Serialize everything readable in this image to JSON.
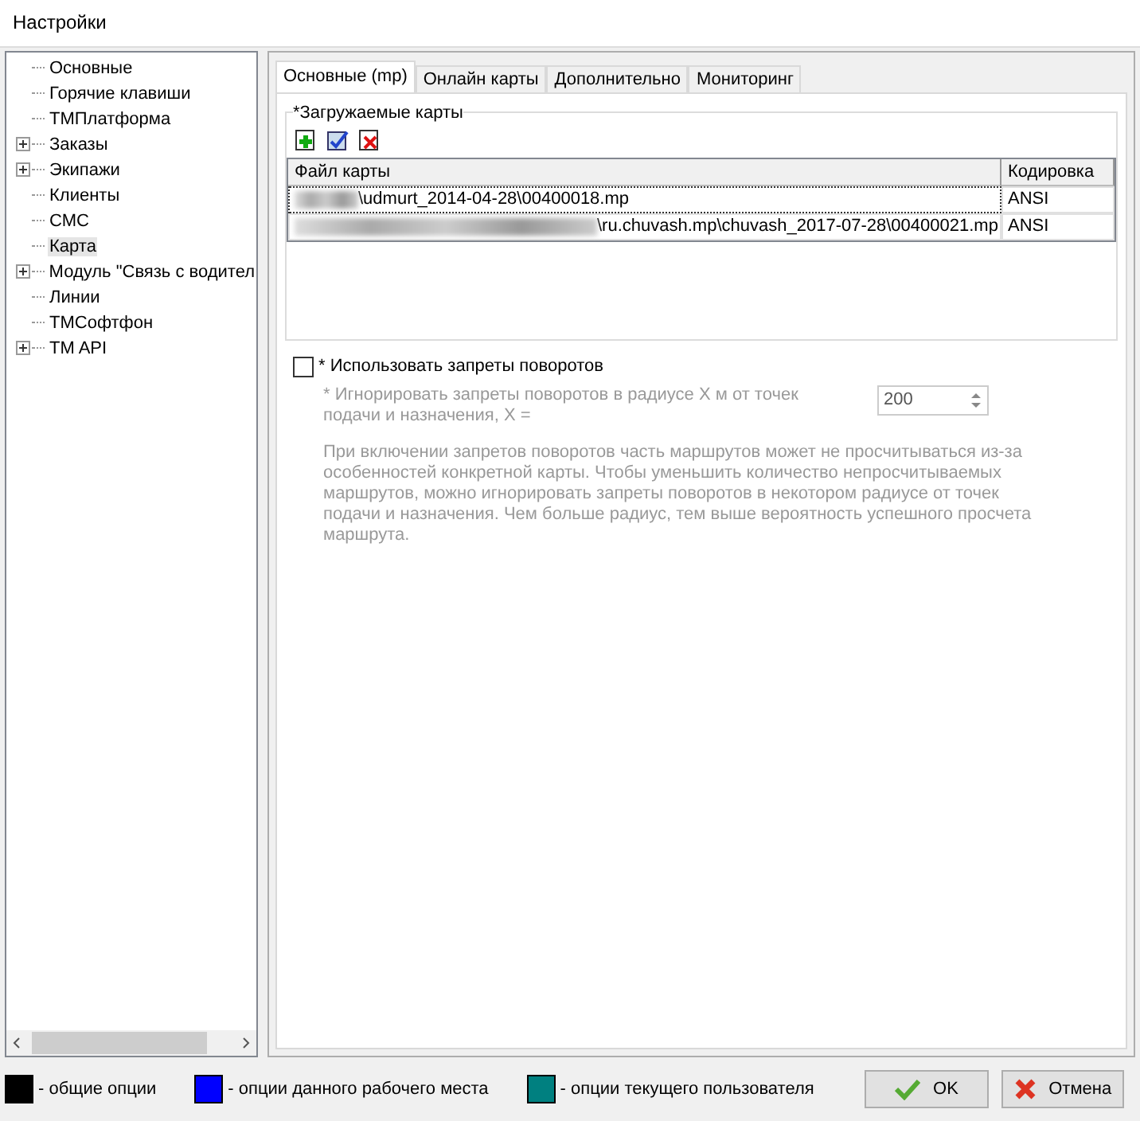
{
  "window": {
    "title": "Настройки"
  },
  "tree": [
    {
      "kind": "leaf",
      "label": "Основные",
      "selected": false
    },
    {
      "kind": "leaf",
      "label": "Горячие клавиши",
      "selected": false
    },
    {
      "kind": "leaf",
      "label": "ТМПлатформа",
      "selected": false
    },
    {
      "kind": "group",
      "label": "Заказы",
      "expanded": false,
      "selected": false
    },
    {
      "kind": "group",
      "label": "Экипажи",
      "expanded": false,
      "selected": false
    },
    {
      "kind": "leaf",
      "label": "Клиенты",
      "selected": false
    },
    {
      "kind": "leaf",
      "label": "СМС",
      "selected": false
    },
    {
      "kind": "leaf",
      "label": "Карта",
      "selected": true
    },
    {
      "kind": "group",
      "label": "Модуль \"Связь с водител",
      "expanded": false,
      "selected": false
    },
    {
      "kind": "leaf",
      "label": "Линии",
      "selected": false
    },
    {
      "kind": "leaf",
      "label": "ТМСофтфон",
      "selected": false
    },
    {
      "kind": "group",
      "label": "TM API",
      "expanded": false,
      "selected": false
    }
  ],
  "tabs": [
    {
      "label": "Основные (mp)",
      "selected": true
    },
    {
      "label": "Онлайн карты",
      "selected": false
    },
    {
      "label": "Дополнительно",
      "selected": false
    },
    {
      "label": "Мониторинг",
      "selected": false
    }
  ],
  "maps_group": {
    "title": "*Загружаемые карты",
    "table": {
      "columns": [
        "Файл карты",
        "Кодировка"
      ],
      "rows": [
        {
          "file": "\\udmurt_2014-04-28\\00400018.mp",
          "encoding": "ANSI",
          "selected": true
        },
        {
          "file": "\\ru.chuvash.mp\\chuvash_2017-07-28\\00400021.mp",
          "encoding": "ANSI",
          "selected": false
        }
      ]
    }
  },
  "turn_restrictions": {
    "label": "* Использовать запреты поворотов",
    "checked": false,
    "ignore_label": "* Игнорировать запреты поворотов в радиусе X м от точек подачи  и назначения, X =",
    "radius": "200",
    "note": "При включении запретов поворотов часть маршрутов может не просчитываться из-за особенностей конкретной карты. Чтобы уменьшить количество непросчитываемых маршрутов, можно игнорировать запреты поворотов в некотором радиусе от точек подачи и назначения. Чем больше радиус, тем выше вероятность успешного просчета маршрута."
  },
  "legend": [
    {
      "label": "- общие опции",
      "color": "#000000"
    },
    {
      "label": "- опции данного рабочего места",
      "color": "#0000ff"
    },
    {
      "label": "- опции текущего пользователя",
      "color": "#008080"
    }
  ],
  "buttons": [
    {
      "kind": "ok",
      "label": "OK"
    },
    {
      "kind": "cancel",
      "label": "Отмена"
    }
  ]
}
